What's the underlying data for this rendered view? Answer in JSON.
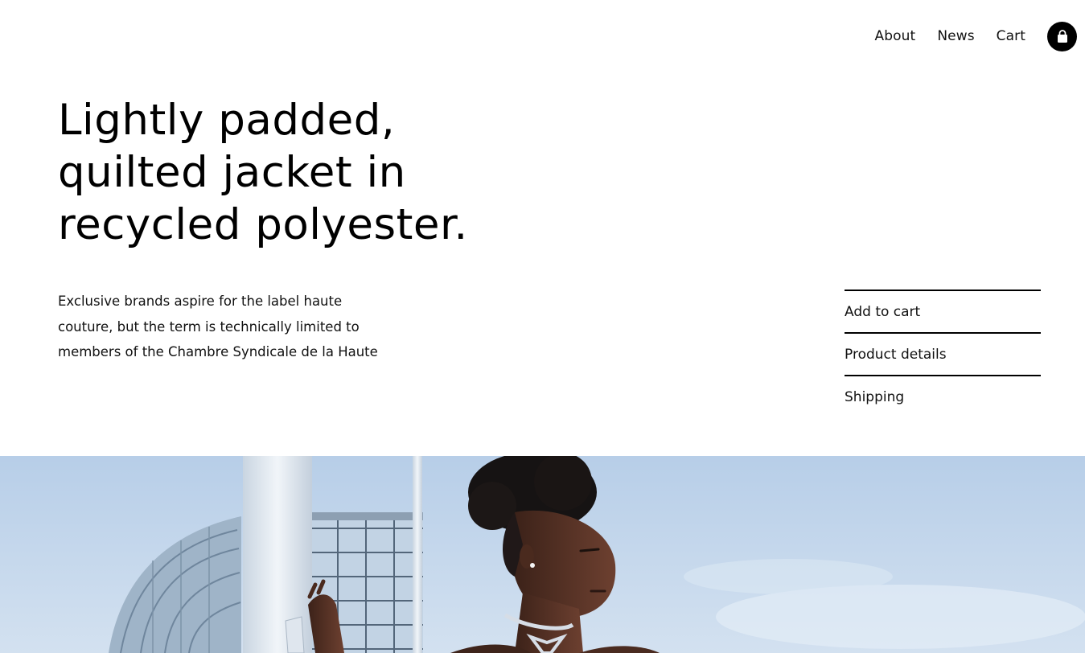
{
  "nav": {
    "links": [
      "About",
      "News",
      "Cart"
    ],
    "bag_icon": "shopping-bag-icon"
  },
  "hero": {
    "title_lines": [
      "Lightly padded,",
      "quilted jacket in",
      "recycled polyester."
    ],
    "description_lines": [
      "Exclusive brands aspire for the label haute",
      "couture, but the term is technically limited to",
      "members of the Chambre Syndicale de la Haute"
    ]
  },
  "accordion": {
    "items": [
      "Add to cart",
      "Product details",
      "Shipping"
    ]
  },
  "photo": {
    "subject": "model-photo",
    "colors": {
      "sky": "#c5d7ec",
      "pole": "#e6edf4",
      "skin": "#5a3426",
      "hair": "#161313"
    }
  }
}
